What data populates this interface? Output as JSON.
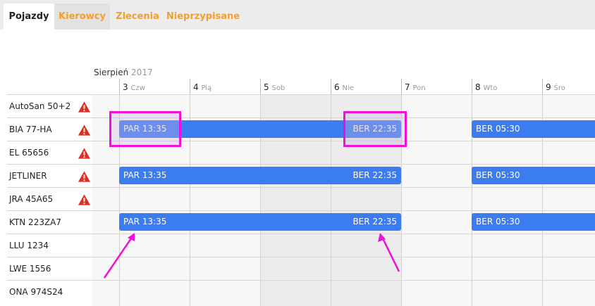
{
  "tabs": [
    {
      "label": "Pojazdy"
    },
    {
      "label": "Kierowcy"
    },
    {
      "label": "Zlecenia"
    },
    {
      "label": "Nieprzypisane"
    }
  ],
  "calendar": {
    "month": "Sierpień",
    "year": "2017",
    "days": [
      {
        "num": "3",
        "name": "Czw"
      },
      {
        "num": "4",
        "name": "Pią"
      },
      {
        "num": "5",
        "name": "Sob"
      },
      {
        "num": "6",
        "name": "Nie"
      },
      {
        "num": "7",
        "name": "Pon"
      },
      {
        "num": "8",
        "name": "Wto"
      },
      {
        "num": "9",
        "name": "Śro"
      }
    ]
  },
  "vehicles": [
    {
      "name": "AutoSan 50+2",
      "warning": true
    },
    {
      "name": "BIA 77-HA",
      "warning": true
    },
    {
      "name": "EL 65656",
      "warning": true
    },
    {
      "name": "JETLINER",
      "warning": true
    },
    {
      "name": "JRA 45A65",
      "warning": true
    },
    {
      "name": "KTN 223ZA7",
      "warning": false
    },
    {
      "name": "LLU 1234",
      "warning": false
    },
    {
      "name": "LWE 1556",
      "warning": false
    },
    {
      "name": "ONA 974S24",
      "warning": false
    }
  ],
  "trips": [
    {
      "start": "PAR 13:35",
      "end": "BER 22:35"
    },
    {
      "start": "BER 05:30"
    },
    {
      "start": "PAR 13:35",
      "end": "BER 22:35"
    },
    {
      "start": "BER 05:30"
    },
    {
      "start": "PAR 13:35",
      "end": "BER 22:35"
    },
    {
      "start": "BER 05:30"
    }
  ],
  "colors": {
    "accent": "#3b7cf0",
    "tab_inactive": "#f0a030",
    "warning": "#d93025",
    "highlight": "#ee10d8"
  },
  "icons": {
    "warning": "warning-icon"
  }
}
